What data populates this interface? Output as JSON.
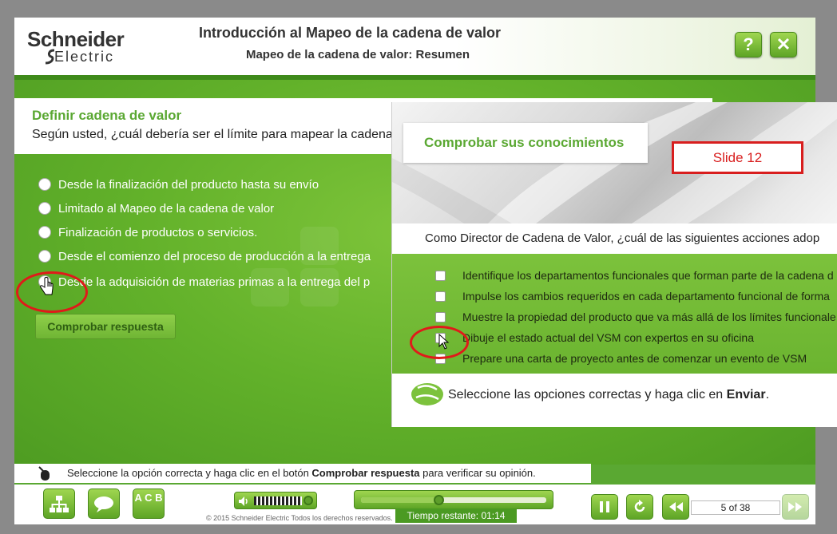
{
  "header": {
    "logo_top": "Schneider",
    "logo_bottom": "Electric",
    "title": "Introducción al Mapeo de la cadena de valor",
    "subtitle": "Mapeo de la cadena de valor: Resumen",
    "help_label": "?",
    "close_label": "✕"
  },
  "question": {
    "title": "Definir cadena de valor",
    "text": "Según usted, ¿cuál debería ser el límite para mapear la cadena",
    "options": [
      "Desde la finalización del producto hasta su envío",
      "Limitado al Mapeo de la cadena de valor",
      "Finalización de productos o servicios.",
      "Desde el comienzo del proceso de producción a la entrega",
      "Desde la adquisición de materias primas a la entrega del p"
    ],
    "check_button": "Comprobar respuesta"
  },
  "instruction": {
    "prefix": "Seleccione la opción correcta y haga clic en el botón ",
    "bold": "Comprobar respuesta",
    "suffix": " para verificar su opinión."
  },
  "overlay": {
    "title": "Comprobar sus conocimientos",
    "slide_label": "Slide 12",
    "question": "Como Director de Cadena de Valor, ¿cuál de las siguientes acciones adop",
    "options": [
      "Identifique los departamentos funcionales que forman parte de la cadena d",
      "Impulse los cambios requeridos en cada departamento funcional de forma",
      "Muestre la propiedad del producto que va más allá de los límites funcionale",
      "Dibuje el estado actual del VSM con expertos en su oficina",
      "Prepare una carta de proyecto antes de comenzar un evento de VSM"
    ],
    "instruction_prefix": "Seleccione las opciones correctas y haga clic en ",
    "instruction_bold": "Enviar",
    "instruction_suffix": "."
  },
  "footer": {
    "copyright": "© 2015 Schneider Electric Todos los derechos reservados.",
    "time_label": "Tiempo restante:  01:14",
    "page_indicator": "5 of 38",
    "progress": 0.42,
    "abc_label": "A C B"
  },
  "colors": {
    "accent": "#5aa832",
    "highlight": "#e01a1a"
  },
  "icons": [
    "help-icon",
    "close-icon",
    "sitemap-icon",
    "chat-bubble-icon",
    "glossary-icon",
    "speaker-icon",
    "pause-icon",
    "replay-icon",
    "rewind-icon",
    "forward-icon",
    "mouse-icon",
    "hand-cursor-icon",
    "pointer-cursor-icon"
  ]
}
